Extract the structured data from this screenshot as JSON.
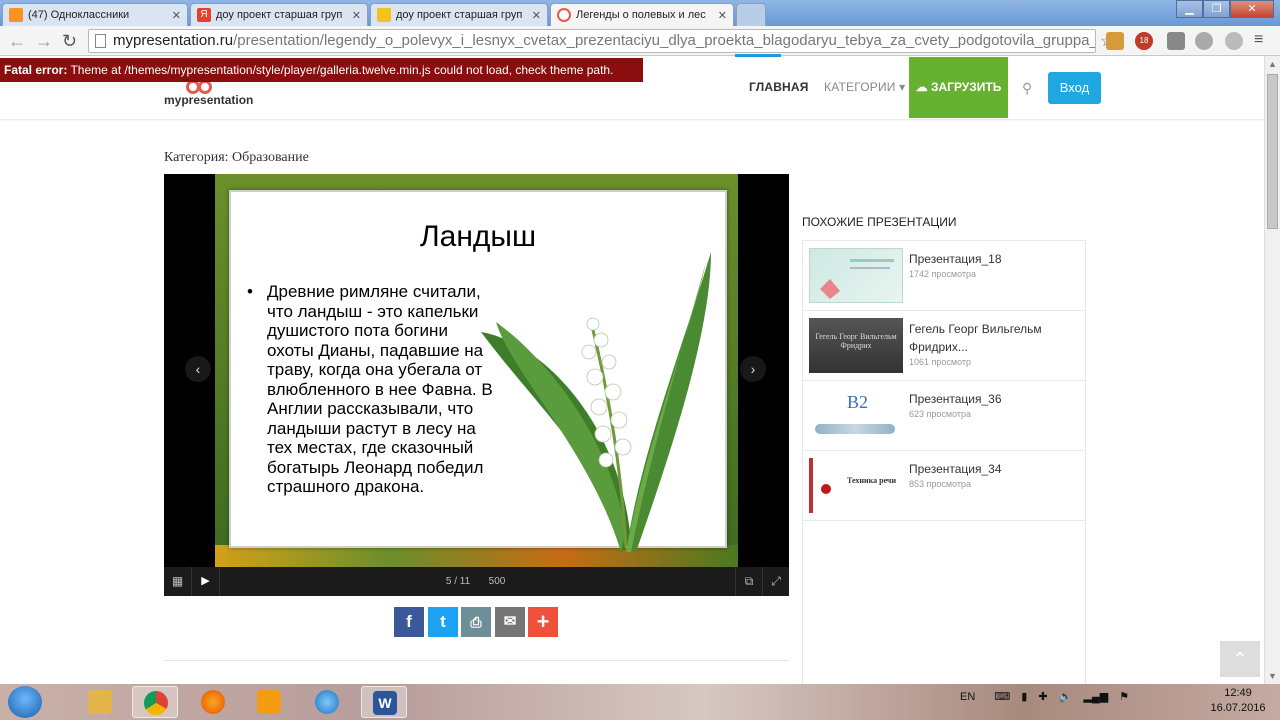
{
  "browser": {
    "tabs": [
      {
        "label": "(47) Одноклассники",
        "icon_color": "#f7931e"
      },
      {
        "label": "доу проект старшая груп",
        "icon_color": "#e8402f"
      },
      {
        "label": "доу проект старшая груп",
        "icon_color": "#f0c419"
      },
      {
        "label": "Легенды о полевых и лес",
        "icon_color": "#e85a4f"
      }
    ],
    "url_host": "mypresentation.ru",
    "url_path": "/presentation/legendy_o_polevyx_i_lesnyx_cvetax_prezentaciyu_dlya_proekta_blagodaryu_tebya_za_cvety_podgotovila_gruppa_i:",
    "ext_badge": "18"
  },
  "error": {
    "label": "Fatal error:",
    "message": " Theme at /themes/mypresentation/style/player/galleria.twelve.min.js could not load, check theme path."
  },
  "header": {
    "logo": "mypresentation",
    "nav": {
      "home": "ГЛАВНАЯ",
      "categories": "КАТЕГОРИИ ▾"
    },
    "upload": "☁ ЗАГРУЗИТЬ",
    "login": "Вход"
  },
  "page": {
    "category": "Категория: Образование"
  },
  "slide": {
    "title": "Ландыш",
    "text": "Древние римляне считали, что ландыш - это капельки душистого пота богини охоты Дианы, падавшие на траву, когда она убегала от влюбленного в нее Фавна. В Англии рассказывали, что ландыши растут в лесу на тех местах, где сказочный богатырь Леонард победил страшного дракона.",
    "counter": "5 / 11",
    "size": "500"
  },
  "sidebar": {
    "title": "ПОХОЖИЕ ПРЕЗЕНТАЦИИ",
    "items": [
      {
        "title": "Презентация_18",
        "views": "1742 просмотра"
      },
      {
        "title": "Гегель Георг Вильгельм Фридрих...",
        "views": "1061 просмотр"
      },
      {
        "title": "Презентация_36",
        "views": "623 просмотра"
      },
      {
        "title": "Презентация_34",
        "views": "853 просмотра"
      }
    ],
    "thumb_texts": [
      "Гегель Георг Вильгельм Фридрих",
      "B2",
      "Техника речи"
    ]
  },
  "taskbar": {
    "lang": "EN",
    "time": "12:49",
    "date": "16.07.2016"
  }
}
